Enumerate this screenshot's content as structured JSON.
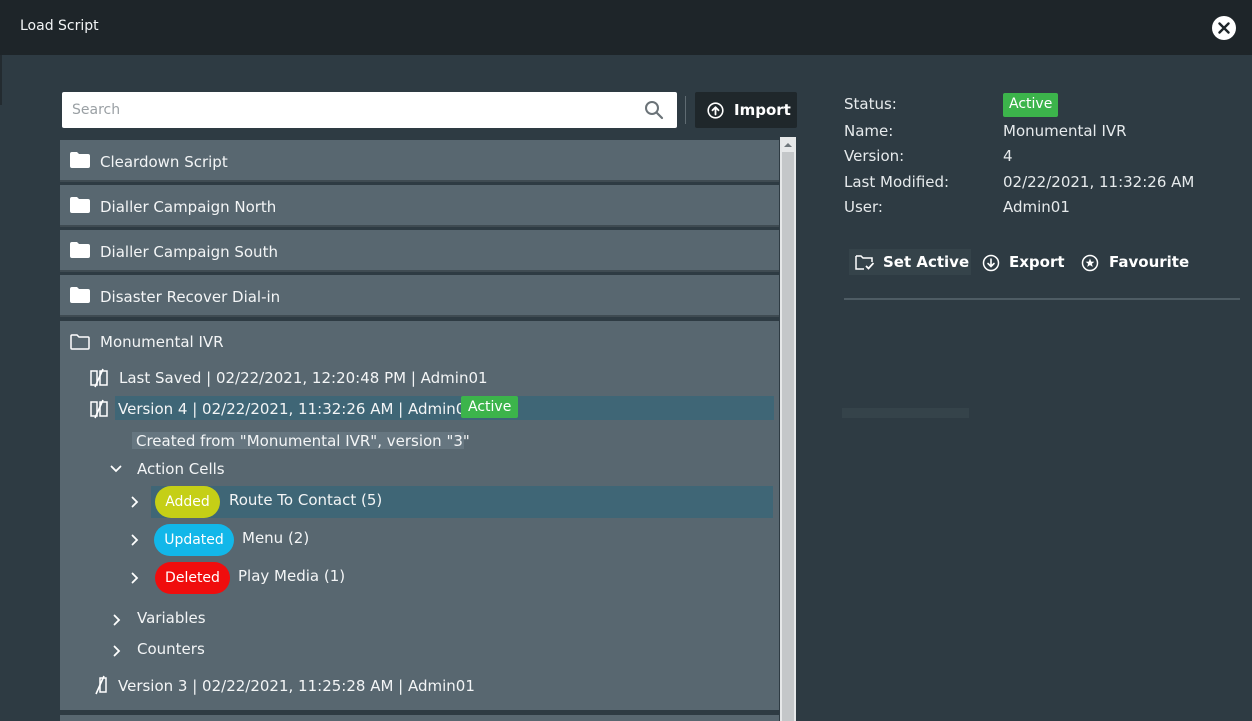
{
  "window": {
    "title": "Load Script",
    "close_icon": "close-icon"
  },
  "search": {
    "placeholder": "Search",
    "value": ""
  },
  "toolbar": {
    "import_label": "Import"
  },
  "folders": [
    {
      "label": "Cleardown Script"
    },
    {
      "label": "Dialler Campaign North"
    },
    {
      "label": "Dialler Campaign South"
    },
    {
      "label": "Disaster Recover Dial-in"
    }
  ],
  "expanded_folder": {
    "label": "Monumental IVR",
    "last_saved": "Last Saved | 02/22/2021, 12:20:48 PM | Admin01",
    "selected_version": {
      "label": "Version 4 | 02/22/2021, 11:32:26 AM | Admin01",
      "badge": "Active",
      "note": "Created from \"Monumental IVR\", version \"3\""
    },
    "action_cells": {
      "label": "Action Cells",
      "items": [
        {
          "badge": "Added",
          "label": "Route To Contact (5)",
          "color": "#c5cf16"
        },
        {
          "badge": "Updated",
          "label": "Menu (2)",
          "color": "#12b7e9"
        },
        {
          "badge": "Deleted",
          "label": "Play Media (1)",
          "color": "#f00d0d"
        }
      ]
    },
    "variables_label": "Variables",
    "counters_label": "Counters",
    "older_version": "Version 3 | 02/22/2021, 11:25:28 AM | Admin01"
  },
  "details": {
    "status_label": "Status:",
    "status_value": "Active",
    "name_label": "Name:",
    "name_value": "Monumental IVR",
    "version_label": "Version:",
    "version_value": "4",
    "modified_label": "Last Modified:",
    "modified_value": "02/22/2021, 11:32:26 AM",
    "user_label": "User:",
    "user_value": "Admin01"
  },
  "actions": {
    "set_active": "Set Active",
    "export": "Export",
    "favourite": "Favourite"
  },
  "colors": {
    "active_green": "#3cb44b",
    "selection": "#3f6676",
    "folder_row": "#586770"
  }
}
